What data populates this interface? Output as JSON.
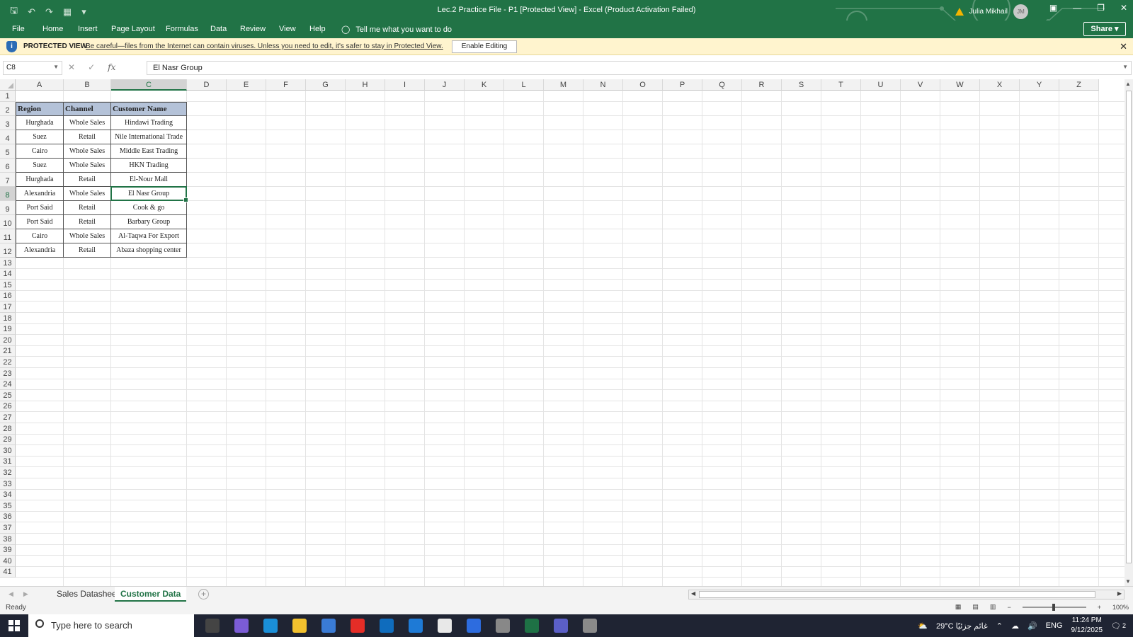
{
  "window": {
    "title": "Lec.2 Practice File - P1  [Protected View]  -  Excel (Product Activation Failed)",
    "user_name": "Julia Mikhail",
    "user_initials": "JM"
  },
  "ribbon": {
    "tabs": [
      "File",
      "Home",
      "Insert",
      "Page Layout",
      "Formulas",
      "Data",
      "Review",
      "View",
      "Help"
    ],
    "tell_me": "Tell me what you want to do",
    "share": "Share"
  },
  "protected_view": {
    "title": "PROTECTED VIEW",
    "message": "Be careful—files from the Internet can contain viruses. Unless you need to edit, it's safer to stay in Protected View.",
    "enable_button": "Enable Editing"
  },
  "formula_bar": {
    "name_box": "C8",
    "fx": "fx",
    "content": "El Nasr Group"
  },
  "grid": {
    "columns": [
      "A",
      "B",
      "C",
      "D",
      "E",
      "F",
      "G",
      "H",
      "I",
      "J",
      "K",
      "L",
      "M",
      "N",
      "O",
      "P",
      "Q",
      "R",
      "S",
      "T",
      "U",
      "V",
      "W",
      "X",
      "Y",
      "Z"
    ],
    "rows": [
      "1",
      "2",
      "3",
      "4",
      "5",
      "6",
      "7",
      "8",
      "9",
      "10",
      "11",
      "12",
      "13",
      "14",
      "15",
      "16",
      "17",
      "18",
      "19",
      "20",
      "21",
      "22",
      "23",
      "24",
      "25",
      "26",
      "27",
      "28",
      "29",
      "30",
      "31",
      "32",
      "33",
      "34",
      "35",
      "36",
      "37",
      "38",
      "39",
      "40",
      "41"
    ],
    "selected_cell": "C8",
    "table_header": [
      "Region",
      "Channel",
      "Customer Name"
    ],
    "table_rows": [
      [
        "Hurghada",
        "Whole Sales",
        "Hindawi Trading"
      ],
      [
        "Suez",
        "Retail",
        "Nile International Trade"
      ],
      [
        "Cairo",
        "Whole Sales",
        "Middle East Trading"
      ],
      [
        "Suez",
        "Whole Sales",
        "HKN Trading"
      ],
      [
        "Hurghada",
        "Retail",
        "El-Nour Mall"
      ],
      [
        "Alexandria",
        "Whole Sales",
        "El Nasr Group"
      ],
      [
        "Port Said",
        "Retail",
        "Cook & go"
      ],
      [
        "Port Said",
        "Retail",
        "Barbary Group"
      ],
      [
        "Cairo",
        "Whole Sales",
        "Al-Taqwa For Export"
      ],
      [
        "Alexandria",
        "Retail",
        "Abaza shopping center"
      ]
    ],
    "header_fill": "#b4c2d8"
  },
  "sheets": {
    "tabs": [
      "Sales Datasheet",
      "Customer Data"
    ],
    "active": "Customer Data"
  },
  "status": {
    "ready": "Ready",
    "zoom": "100%"
  },
  "taskbar": {
    "search_placeholder": "Type here to search",
    "weather": "29°C  غائم جزئيًا",
    "language": "ENG",
    "time": "11:24 PM",
    "date": "9/12/2025",
    "notifications": "2"
  },
  "colors": {
    "excel_green": "#217346",
    "protected_bar": "#fff4ce",
    "taskbar": "#1f2433"
  }
}
